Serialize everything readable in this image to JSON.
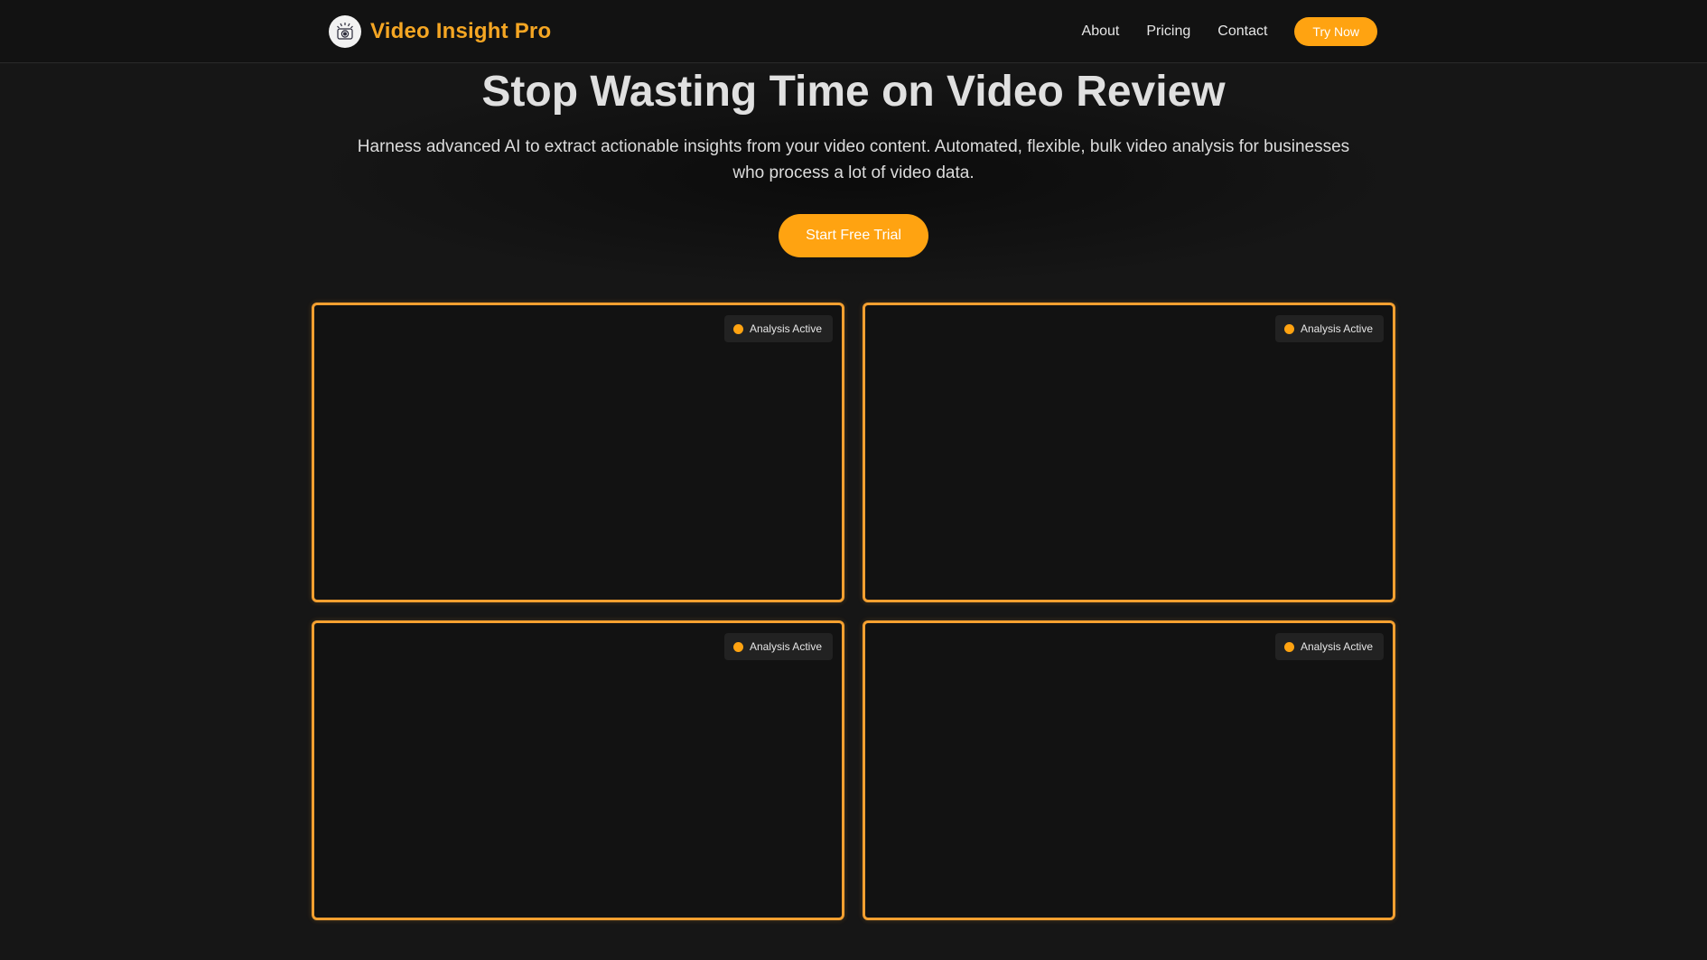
{
  "colors": {
    "accent": "#ffa311",
    "brand_text": "#f5a623",
    "background": "#161616",
    "panel_border": "#f5a030"
  },
  "header": {
    "brand": "Video Insight Pro",
    "logo_icon": "camera-eye-icon",
    "nav": [
      {
        "label": "About"
      },
      {
        "label": "Pricing"
      },
      {
        "label": "Contact"
      }
    ],
    "cta_label": "Try Now"
  },
  "hero": {
    "title": "Stop Wasting Time on Video Review",
    "subtitle_line1": "Harness advanced AI to extract actionable insights from your video content. Automated, flexible, bulk video analysis for businesses",
    "subtitle_line2": "who process a lot of video data.",
    "cta_label": "Start Free Trial"
  },
  "panels": [
    {
      "status": "Analysis Active"
    },
    {
      "status": "Analysis Active"
    },
    {
      "status": "Analysis Active"
    },
    {
      "status": "Analysis Active"
    }
  ]
}
